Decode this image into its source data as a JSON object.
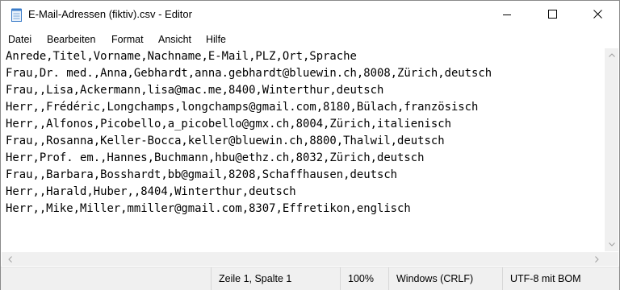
{
  "window": {
    "title": "E-Mail-Adressen (fiktiv).csv - Editor",
    "app_icon": "notepad-icon",
    "controls": {
      "minimize": "minimize-icon",
      "maximize": "maximize-icon",
      "close": "close-icon"
    }
  },
  "menu": [
    {
      "label": "Datei"
    },
    {
      "label": "Bearbeiten"
    },
    {
      "label": "Format"
    },
    {
      "label": "Ansicht"
    },
    {
      "label": "Hilfe"
    }
  ],
  "editor": {
    "lines": [
      "Anrede,Titel,Vorname,Nachname,E-Mail,PLZ,Ort,Sprache",
      "Frau,Dr. med.,Anna,Gebhardt,anna.gebhardt@bluewin.ch,8008,Zürich,deutsch",
      "Frau,,Lisa,Ackermann,lisa@mac.me,8400,Winterthur,deutsch",
      "Herr,,Frédéric,Longchamps,longchamps@gmail.com,8180,Bülach,französisch",
      "Herr,,Alfonos,Picobello,a_picobello@gmx.ch,8004,Zürich,italienisch",
      "Frau,,Rosanna,Keller-Bocca,keller@bluewin.ch,8800,Thalwil,deutsch",
      "Herr,Prof. em.,Hannes,Buchmann,hbu@ethz.ch,8032,Zürich,deutsch",
      "Frau,,Barbara,Bosshardt,bb@gmail,8208,Schaffhausen,deutsch",
      "Herr,,Harald,Huber,,8404,Winterthur,deutsch",
      "Herr,,Mike,Miller,mmiller@gmail.com,8307,Effretikon,englisch"
    ]
  },
  "scrollbars": {
    "up": "arrow-up-icon",
    "down": "arrow-down-icon",
    "left": "arrow-left-icon",
    "right": "arrow-right-icon"
  },
  "status": {
    "position": "Zeile 1, Spalte 1",
    "zoom": "100%",
    "line_endings": "Windows (CRLF)",
    "encoding": "UTF-8 mit BOM"
  }
}
